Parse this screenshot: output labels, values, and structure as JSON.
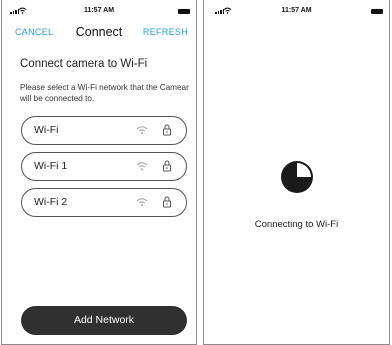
{
  "status_bar": {
    "time": "11:57 AM"
  },
  "connect_screen": {
    "nav": {
      "cancel": "CANCEL",
      "title": "Connect",
      "refresh": "REFRESH"
    },
    "heading": "Connect camera to Wi-Fi",
    "description": "Please select a Wi-Fi network that the Camear will be connected to.",
    "networks": [
      {
        "name": "Wi-Fi",
        "icons": [
          "wifi-icon",
          "lock-icon"
        ]
      },
      {
        "name": "Wi-Fi 1",
        "icons": [
          "wifi-icon",
          "lock-icon"
        ]
      },
      {
        "name": "Wi-Fi 2",
        "icons": [
          "wifi-icon",
          "lock-icon"
        ]
      }
    ],
    "add_network": "Add Network"
  },
  "connecting_screen": {
    "message": "Connecting to Wi-Fi",
    "spinner_icon": "progress-spinner-icon"
  },
  "colors": {
    "accent": "#2a9fd6",
    "button_dark": "#303030"
  }
}
